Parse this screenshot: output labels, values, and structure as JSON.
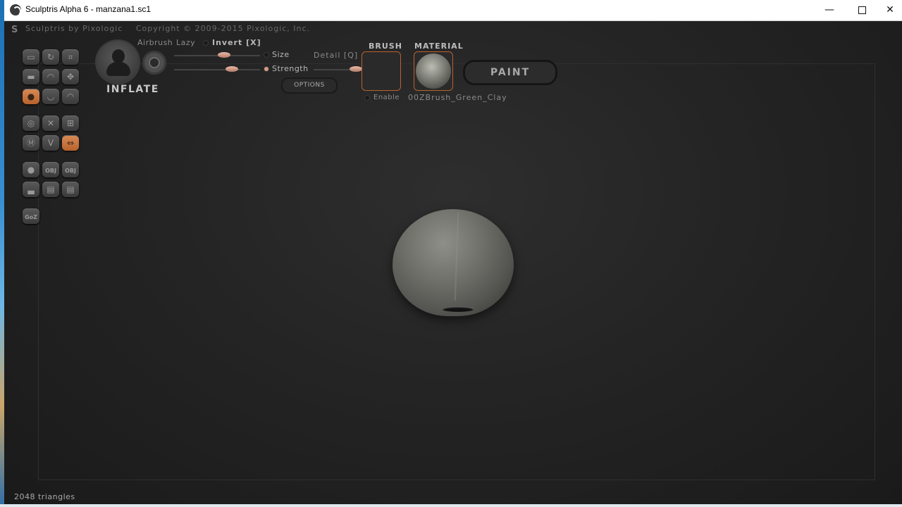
{
  "window": {
    "title": "Sculptris Alpha 6 - manzana1.sc1",
    "controls": {
      "minimize": "—",
      "maximize": "",
      "close": "✕"
    }
  },
  "header": {
    "brand": "Sculptris by Pixologic",
    "copyright": "Copyright © 2009-2015 Pixologic, Inc."
  },
  "tools": [
    {
      "name": "draw-tool",
      "icon": "draw-icon",
      "glyph": "▭",
      "active": false
    },
    {
      "name": "rotate-tool",
      "icon": "rotate-icon",
      "glyph": "↻",
      "active": false
    },
    {
      "name": "crop-tool",
      "icon": "crop-icon",
      "glyph": "⌗",
      "active": false
    },
    {
      "name": "flatten-tool",
      "icon": "flatten-icon",
      "glyph": "▬",
      "active": false
    },
    {
      "name": "smooth-tool",
      "icon": "smooth-icon",
      "glyph": "◠",
      "active": false
    },
    {
      "name": "grab-tool",
      "icon": "move-icon",
      "glyph": "✥",
      "active": false
    },
    {
      "name": "inflate-tool",
      "icon": "inflate-icon",
      "glyph": "●",
      "active": true
    },
    {
      "name": "pinch-tool",
      "icon": "pinch-icon",
      "glyph": "◡",
      "active": false
    },
    {
      "name": "crease-tool",
      "icon": "crease-icon",
      "glyph": "◠",
      "active": false
    },
    {
      "name": "symmetry-tool",
      "icon": "symmetry-icon",
      "glyph": "◎",
      "active": false
    },
    {
      "name": "wireframe-tool",
      "icon": "cross-icon",
      "glyph": "✕",
      "active": false
    },
    {
      "name": "grid-tool",
      "icon": "grid-icon",
      "glyph": "⊞",
      "active": false
    },
    {
      "name": "mask-tool",
      "icon": "mask-icon",
      "glyph": "Ⓜ",
      "active": false
    },
    {
      "name": "reduce-tool",
      "icon": "reduce-icon",
      "glyph": "V",
      "active": false
    },
    {
      "name": "mirror-tool",
      "icon": "mirror-icon",
      "glyph": "⇔",
      "active": true
    },
    {
      "name": "sphere-tool",
      "icon": "sphere-icon",
      "glyph": "●",
      "active": false
    },
    {
      "name": "import-obj-tool",
      "icon": "import-obj-icon",
      "glyph": "OBJ",
      "active": false
    },
    {
      "name": "export-obj-tool",
      "icon": "export-obj-icon",
      "glyph": "OBJ",
      "active": false
    },
    {
      "name": "plane-tool",
      "icon": "plane-icon",
      "glyph": "▃",
      "active": false
    },
    {
      "name": "open-tool",
      "icon": "open-icon",
      "glyph": "▤",
      "active": false
    },
    {
      "name": "save-tool",
      "icon": "save-icon",
      "glyph": "▤",
      "active": false
    },
    {
      "name": "goz-tool",
      "icon": "goz-icon",
      "glyph": "GoZ",
      "active": false
    }
  ],
  "brush": {
    "name": "INFLATE",
    "airbrush": "Airbrush",
    "lazy": "Lazy",
    "invert": "Invert [X]",
    "size": "Size",
    "strength": "Strength",
    "detail": "Detail [Q]",
    "options": "OPTIONS",
    "size_value": 0.6,
    "strength_value": 0.7,
    "detail_value": 0.85
  },
  "brush_panel": {
    "title": "BRUSH",
    "enable": "Enable"
  },
  "material_panel": {
    "title": "MATERIAL",
    "name": "00ZBrush_Green_Clay"
  },
  "paint_button": "PAINT",
  "status": {
    "triangles": "2048 triangles"
  },
  "colors": {
    "accent": "#b8622d",
    "background": "#202020",
    "model": "#6f706a"
  }
}
